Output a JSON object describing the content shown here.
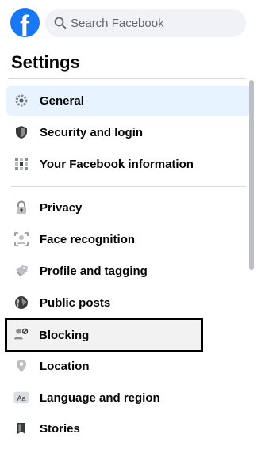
{
  "header": {
    "logo_letter": "f",
    "search": {
      "placeholder": "Search Facebook",
      "value": ""
    }
  },
  "page_title": "Settings",
  "sidebar": {
    "items": [
      {
        "label": "General",
        "icon": "gear-icon",
        "state": "selected"
      },
      {
        "label": "Security and login",
        "icon": "shield-icon"
      },
      {
        "label": "Your Facebook information",
        "icon": "facebook-info-icon"
      },
      {
        "label": "Privacy",
        "icon": "lock-icon"
      },
      {
        "label": "Face recognition",
        "icon": "face-recognition-icon"
      },
      {
        "label": "Profile and tagging",
        "icon": "tag-icon"
      },
      {
        "label": "Public posts",
        "icon": "globe-icon"
      },
      {
        "label": "Blocking",
        "icon": "blocking-icon",
        "state": "highlighted"
      },
      {
        "label": "Location",
        "icon": "location-pin-icon"
      },
      {
        "label": "Language and region",
        "icon": "language-icon"
      },
      {
        "label": "Stories",
        "icon": "stories-icon"
      }
    ]
  },
  "colors": {
    "brand": "#1877f2",
    "selected_bg": "#e7f3ff",
    "highlight_border": "#000000"
  }
}
